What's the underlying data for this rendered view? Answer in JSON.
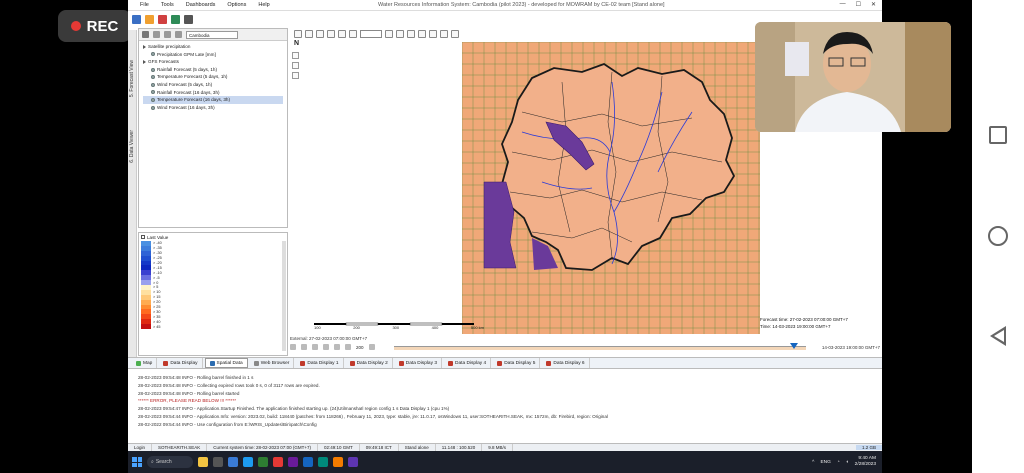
{
  "recording": {
    "label": "REC"
  },
  "app": {
    "title": "Water Resources Information System: Cambodia (pilot 2023) - developed for MOWRAM by CE-02 team [Stand alone]",
    "menu": [
      "File",
      "Tools",
      "Dashboards",
      "Options",
      "Help"
    ]
  },
  "side_tabs": [
    "5. Forecast View",
    "6. Data Viewer"
  ],
  "left_panel": {
    "region_select": "Cambodia",
    "tree": [
      {
        "label": "Satellite precipitation",
        "level": 0,
        "expander": true
      },
      {
        "label": "Precipitation GPM Late [mm]",
        "level": 1
      },
      {
        "label": "GFS Forecasts",
        "level": 0,
        "expander": true
      },
      {
        "label": "Rainfall Forecast (5 days, 1h)",
        "level": 1
      },
      {
        "label": "Temperature Forecast (5 days, 1h)",
        "level": 1
      },
      {
        "label": "Wind Forecast (5 days, 1h)",
        "level": 1
      },
      {
        "label": "Rainfall Forecast (16 days, 3h)",
        "level": 1
      },
      {
        "label": "Temperature Forecast (16 days, 3h)",
        "level": 1,
        "selected": true
      },
      {
        "label": "Wind Forecast (16 days, 3h)",
        "level": 1
      }
    ]
  },
  "legend": {
    "header": "Last Value",
    "rows": [
      {
        "label": "> -40",
        "color": "#4a90e2"
      },
      {
        "label": "> -35",
        "color": "#3d7ddc"
      },
      {
        "label": "> -30",
        "color": "#2e63d6"
      },
      {
        "label": "> -25",
        "color": "#1f4fd0"
      },
      {
        "label": "> -20",
        "color": "#1438c8"
      },
      {
        "label": "> -15",
        "color": "#0d27c0"
      },
      {
        "label": "> -10",
        "color": "#3a3fd0"
      },
      {
        "label": "> -5",
        "color": "#6a6ee0"
      },
      {
        "label": "> 0",
        "color": "#9aa0ee"
      },
      {
        "label": "> 5",
        "color": "#fff3c8"
      },
      {
        "label": "> 10",
        "color": "#ffe0a0"
      },
      {
        "label": "> 15",
        "color": "#ffc878"
      },
      {
        "label": "> 20",
        "color": "#ffab50"
      },
      {
        "label": "> 25",
        "color": "#ff8c30"
      },
      {
        "label": "> 30",
        "color": "#ff6a20"
      },
      {
        "label": "> 35",
        "color": "#f44818"
      },
      {
        "label": "> 40",
        "color": "#e02810"
      },
      {
        "label": "> 45",
        "color": "#c41010"
      }
    ]
  },
  "map": {
    "forecast_time": "Forecast time: 27-02-2023 07:00:00 GMT+7",
    "time": "Time: 14-03-2023 19:00:00 GMT+7",
    "scale_labels": [
      "100",
      "200",
      "300",
      "400",
      "500 km"
    ],
    "base_color": "#f0a878",
    "grid_color": "#5a8a3a",
    "lake_color": "#6a3a9a"
  },
  "timebar": {
    "external": "External: 27-02-2023 07:00:00 GMT+7",
    "step": "200",
    "end_time": "14-03-2023 19:00:00 GMT+7"
  },
  "tabs": [
    {
      "label": "Map",
      "color": "#4caf50"
    },
    {
      "label": "Data Display",
      "color": "#c0392b"
    },
    {
      "label": "Spatial Data",
      "color": "#2b6cb0",
      "active": true
    },
    {
      "label": "Web Browser",
      "color": "#888"
    },
    {
      "label": "Data Display 1",
      "color": "#c0392b"
    },
    {
      "label": "Data Display 2",
      "color": "#c0392b"
    },
    {
      "label": "Data Display 3",
      "color": "#c0392b"
    },
    {
      "label": "Data Display 4",
      "color": "#c0392b"
    },
    {
      "label": "Data Display 5",
      "color": "#c0392b"
    },
    {
      "label": "Data Display 6",
      "color": "#c0392b"
    }
  ],
  "log": [
    {
      "text": "28-02-2023 09:54:48 INFO - Rolling barrel finished in 1 s"
    },
    {
      "text": "28-02-2023 09:54:48 INFO - Collecting expired rows took 0 s, 0 of 3117 rows are expired."
    },
    {
      "text": "28-02-2023 09:54:48 INFO - Rolling barrel started"
    },
    {
      "text": "****** ERROR, PLEASE READ BELOW !!! ******",
      "err": true
    },
    {
      "text": "28-02-2023 09:54:47 INFO - Application.Startup Finished. The application finished starting up. (24)UtilmanshaIl region config 1 s Data Display 1 (cpu 1%)"
    },
    {
      "text": "28-02-2023 09:54:44 INFO - Application.Info: version: 2023.02, build: 118440 (patches: from 118266) , February 11, 2023, type: stable, jre: 11.0.17, osWindows 11, user:SOTHEARITH.SEAK, mx: 1572m, db: Firebird, region: Original"
    },
    {
      "text": "28-02-2022 09:54:44 INFO - Use configuration from E:\\WRIS_Updates\\Bin\\patch\\Config"
    }
  ],
  "statusbar": {
    "cells": [
      "Login",
      "SOTHEARITH.SEAK",
      "Current system time: 28-02-2023 07:00 (GMT+7)",
      "02:49:10 GMT",
      "09:49:18 ICT",
      "Stand alone",
      "11.148 : 100.520",
      "9.8 MB/s"
    ],
    "memory": "1.2 GB"
  },
  "taskbar": {
    "search": "Search",
    "lang": "ENG",
    "time": "9:40 AM",
    "date": "2/28/2023"
  }
}
